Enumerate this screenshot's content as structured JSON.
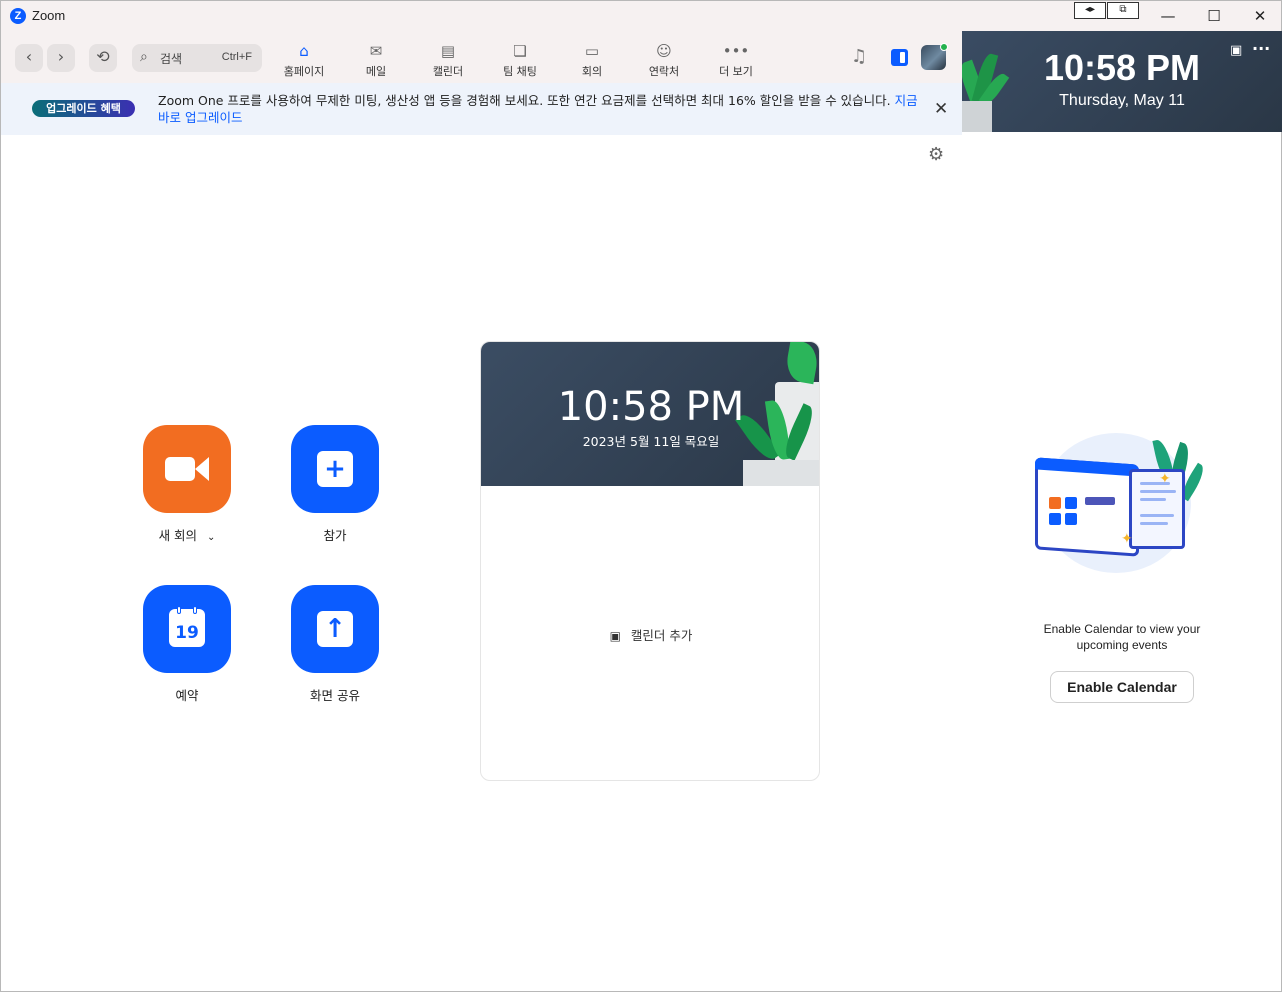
{
  "window": {
    "title": "Zoom",
    "logo_letter": "Z",
    "controls": {
      "minimize": "—",
      "maximize": "☐",
      "close": "✕"
    }
  },
  "toolbar": {
    "search_placeholder": "검색",
    "search_shortcut": "Ctrl+F",
    "tabs": [
      {
        "label": "홈페이지",
        "icon": "home-icon",
        "active": true
      },
      {
        "label": "메일",
        "icon": "mail-icon",
        "active": false
      },
      {
        "label": "캘린더",
        "icon": "calendar-icon",
        "active": false
      },
      {
        "label": "팀 채팅",
        "icon": "chat-icon",
        "active": false
      },
      {
        "label": "회의",
        "icon": "video-icon",
        "active": false
      },
      {
        "label": "연락처",
        "icon": "contacts-icon",
        "active": false
      },
      {
        "label": "더 보기",
        "icon": "more-icon",
        "active": false
      }
    ]
  },
  "banner": {
    "badge": "업그레이드 혜택",
    "text": "Zoom One 프로를 사용하여 무제한 미팅, 생산성 앱 등을 경험해 보세요. 또한 연간 요금제를 선택하면 최대 16% 할인을 받을 수 있습니다.",
    "link": "지금 바로 업그레이드"
  },
  "clock_widget": {
    "time": "10:58 PM",
    "date": "Thursday, May 11"
  },
  "actions": {
    "new_meeting": "새 회의",
    "join": "참가",
    "schedule": "예약",
    "schedule_day": "19",
    "share_screen": "화면 공유"
  },
  "center_card": {
    "time": "10:58 PM",
    "date": "2023년 5월 11일 목요일",
    "add_calendar": "캘린더 추가"
  },
  "calendar_promo": {
    "text": "Enable Calendar to view your upcoming events",
    "button": "Enable Calendar"
  },
  "colors": {
    "accent": "#0b5cff",
    "new_meeting": "#f26d21",
    "header_bg": "#2f3e50"
  }
}
